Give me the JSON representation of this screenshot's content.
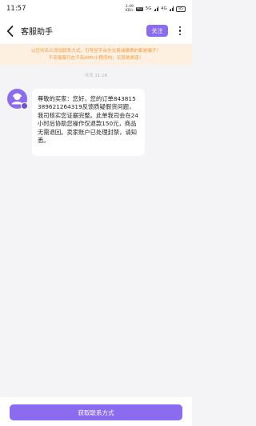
{
  "status_bar": {
    "time": "11:57",
    "net_speed_value": "2.49",
    "net_speed_unit": "KB/s",
    "hd_label": "HD",
    "signal1": "5G",
    "signal2": "4G",
    "battery": "85"
  },
  "header": {
    "title": "客服助手",
    "follow_label": "关注"
  },
  "warning": {
    "line1": "以任何名义添加联系方式，引导至平台外交易或缴费的都是骗子！",
    "line2": "千岛客服只在千岛APP/小程序内，无其他渠道！"
  },
  "chat": {
    "timestamp": "今天 11:16",
    "message": "尊敬的买家：您好，您的订单843815389621264319反馈质疑假货问题，我司核实您证据完整。此单我司会在24小时后协助您操作仅退款150元，商品无需退回。卖家账户已处理封禁，请知悉。"
  },
  "bottom": {
    "cta_label": "获取联系方式"
  },
  "colors": {
    "accent": "#8b6cf0",
    "warning_bg": "#fdf0e1",
    "warning_text": "#f39a3a"
  }
}
